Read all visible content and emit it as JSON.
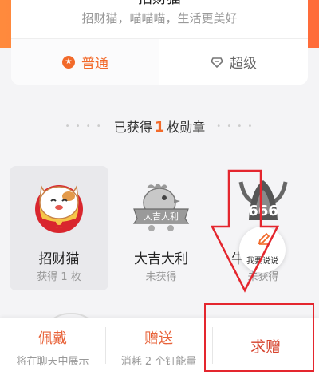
{
  "header": {
    "title": "招财猫",
    "subtitle": "招财猫，喵喵喵，生活更美好"
  },
  "tabs": [
    {
      "label": "普通",
      "icon": "star-circle-icon",
      "active": true
    },
    {
      "label": "超级",
      "icon": "diamond-icon",
      "active": false
    }
  ],
  "section": {
    "prefix": "已获得",
    "count": "1",
    "suffix": "枚勋章"
  },
  "badges": [
    {
      "name": "招财猫",
      "status": "获得 1 枚"
    },
    {
      "name": "大吉大利",
      "status": "未获得",
      "emblem_text": "大吉大利"
    },
    {
      "name": "牛",
      "status": "未获得",
      "emblem_text": "666"
    }
  ],
  "float_button": {
    "label": "我要说说"
  },
  "bottom_bar": {
    "wear": {
      "label": "佩戴",
      "sub": "将在聊天中展示"
    },
    "gift": {
      "label": "赠送",
      "sub": "消耗 2 个钉能量"
    },
    "request": {
      "label": "求赠"
    }
  },
  "colors": {
    "accent": "#f26a2a",
    "annotation_red": "#e4262e",
    "header_gradient_start": "#ff8a3d",
    "header_gradient_end": "#ff6b3a"
  }
}
